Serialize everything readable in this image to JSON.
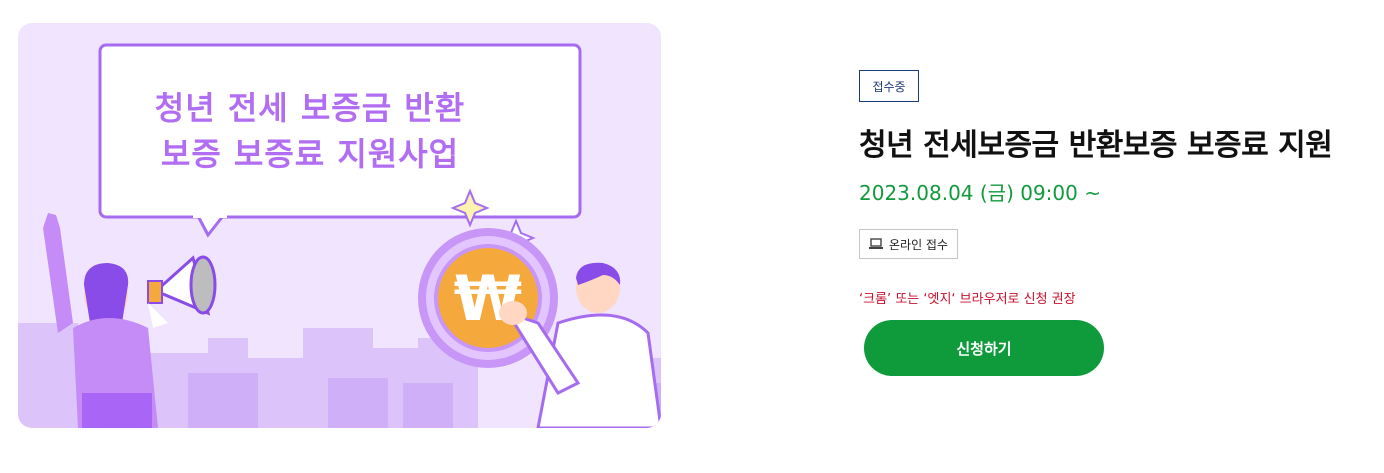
{
  "banner": {
    "line1": "청년 전세 보증금 반환",
    "line2": "보증 보증료 지원사업",
    "currency_symbol": "₩"
  },
  "badge": "접수중",
  "title": "청년 전세보증금 반환보증 보증료 지원",
  "date": "2023.08.04 (금) 09:00 ~",
  "method": {
    "icon": "laptop-icon",
    "label": "온라인 접수"
  },
  "notice": "‘크롬’ 또는 ‘엣지‘ 브라우저로 신청 권장",
  "apply_label": "신청하기",
  "colors": {
    "accent_green": "#0f9a3c",
    "badge_navy": "#1a3a7a",
    "notice_red": "#c8102e",
    "banner_purple": "#b16ef2"
  }
}
